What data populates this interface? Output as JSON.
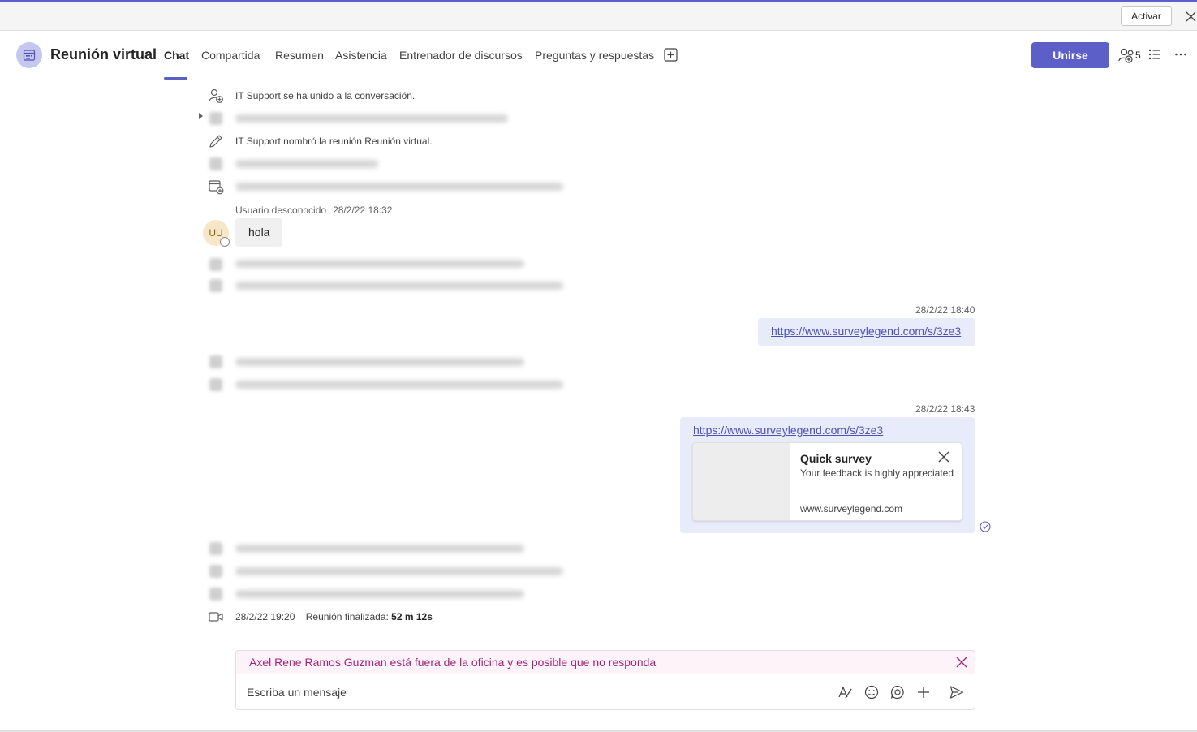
{
  "window": {
    "activate_label": "Activar"
  },
  "header": {
    "title": "Reunión virtual",
    "tabs": [
      {
        "label": "Chat",
        "active": true
      },
      {
        "label": "Compartida"
      },
      {
        "label": "Resumen"
      },
      {
        "label": "Asistencia"
      },
      {
        "label": "Entrenador de discursos"
      },
      {
        "label": "Preguntas y respuestas"
      }
    ],
    "join_label": "Unirse",
    "participants_count": "5"
  },
  "events": {
    "joined": "IT Support se ha unido a la conversación.",
    "renamed": "IT Support nombró la reunión Reunión virtual."
  },
  "message_in": {
    "sender": "Usuario desconocido",
    "timestamp": "28/2/22 18:32",
    "avatar_initials": "UU",
    "text": "hola"
  },
  "message_out_1": {
    "timestamp": "28/2/22 18:40",
    "link": "https://www.surveylegend.com/s/3ze3"
  },
  "message_out_2": {
    "timestamp": "28/2/22 18:43",
    "link": "https://www.surveylegend.com/s/3ze3",
    "preview": {
      "title": "Quick survey",
      "description": "Your feedback is highly appreciated",
      "domain": "www.surveylegend.com"
    }
  },
  "meeting_end": {
    "timestamp": "28/2/22 19:20",
    "label": "Reunión finalizada:",
    "duration": "52 m 12s"
  },
  "compose": {
    "ooo_notice": "Axel Rene Ramos Guzman está fuera de la oficina y es posible que no responda",
    "placeholder": "Escriba un mensaje"
  },
  "colors": {
    "brand": "#5b5fc7",
    "ooo_text": "#a4237a",
    "bubble_out": "#e8ebfa"
  }
}
